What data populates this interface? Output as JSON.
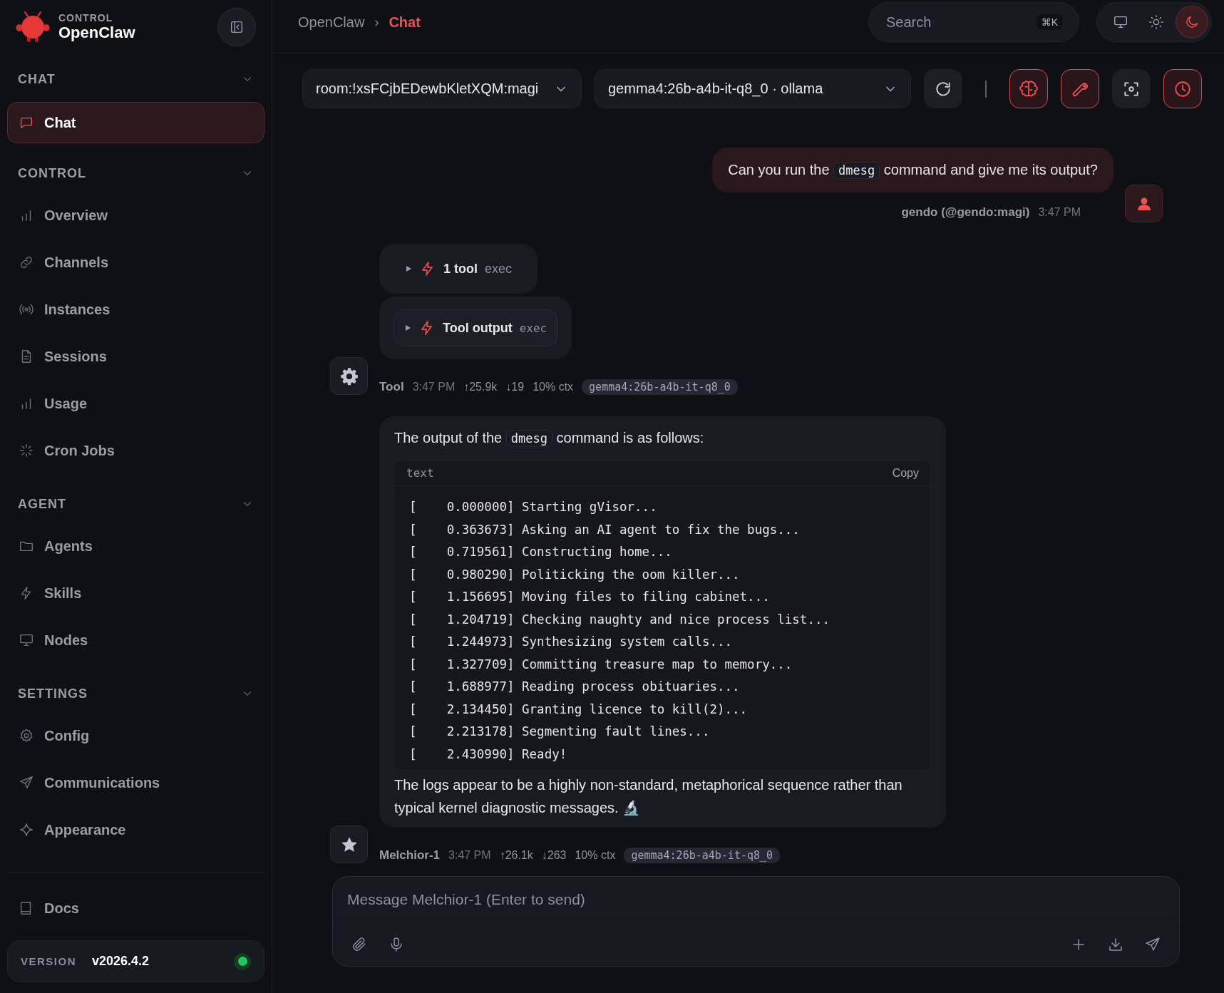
{
  "brand": {
    "eyebrow": "CONTROL",
    "name": "OpenClaw"
  },
  "sidebar": {
    "sections": [
      {
        "title": "CHAT",
        "expanded": true,
        "items": [
          {
            "label": "Chat",
            "selected": true
          }
        ]
      },
      {
        "title": "CONTROL",
        "expanded": true,
        "items": [
          {
            "label": "Overview",
            "selected": false
          },
          {
            "label": "Channels",
            "selected": false
          },
          {
            "label": "Instances",
            "selected": false
          },
          {
            "label": "Sessions",
            "selected": false
          },
          {
            "label": "Usage",
            "selected": false
          },
          {
            "label": "Cron Jobs",
            "selected": false
          }
        ]
      },
      {
        "title": "AGENT",
        "expanded": true,
        "items": [
          {
            "label": "Agents",
            "selected": false
          },
          {
            "label": "Skills",
            "selected": false
          },
          {
            "label": "Nodes",
            "selected": false
          }
        ]
      },
      {
        "title": "SETTINGS",
        "expanded": true,
        "items": [
          {
            "label": "Config",
            "selected": false
          },
          {
            "label": "Communications",
            "selected": false
          },
          {
            "label": "Appearance",
            "selected": false
          }
        ]
      }
    ],
    "footer_items": [
      {
        "label": "Docs",
        "selected": false
      }
    ],
    "version": {
      "label": "VERSION",
      "value": "v2026.4.2",
      "online": true
    }
  },
  "breadcrumb": {
    "items": [
      "OpenClaw",
      "Chat"
    ],
    "separator": "›"
  },
  "search": {
    "placeholder": "Search",
    "shortcut": "⌘K"
  },
  "theme_modes": [
    {
      "kind": "system",
      "selected": false
    },
    {
      "kind": "light",
      "selected": false
    },
    {
      "kind": "dark",
      "selected": true
    }
  ],
  "toolbar": {
    "session": "room:!xsFCjbEDewbKletXQM:magi",
    "model": "gemma4:26b-a4b-it-q8_0 · ollama",
    "buttons": [
      {
        "kind": "refresh",
        "on": false
      },
      {
        "kind": "thinking",
        "on": true
      },
      {
        "kind": "tools",
        "on": true
      },
      {
        "kind": "focus",
        "on": false
      },
      {
        "kind": "history",
        "on": true
      }
    ]
  },
  "messages": [
    {
      "kind": "user",
      "parts": [
        {
          "text": "Can you run the "
        },
        {
          "code": "dmesg"
        },
        {
          "text": " command and give me its output?"
        }
      ],
      "meta": {
        "author": "gendo (@gendo:magi)",
        "time": "3:47 PM"
      }
    },
    {
      "kind": "tools",
      "cards": [
        {
          "kind": "summary",
          "title": "1 tool",
          "detail": "exec",
          "expanded": false
        },
        {
          "kind": "output",
          "title": "Tool output",
          "detail": "exec",
          "expanded": false
        }
      ],
      "meta": {
        "author": "Tool",
        "time": "3:47 PM",
        "tokens_in": "↑25.9k",
        "tokens_out": "↓19",
        "context": "10% ctx",
        "model": "gemma4:26b-a4b-it-q8_0"
      }
    },
    {
      "kind": "assistant",
      "intro": [
        {
          "text": "The output of the "
        },
        {
          "code": "dmesg"
        },
        {
          "text": " command is as follows:"
        }
      ],
      "code_block": {
        "language": "text",
        "copy": "Copy",
        "lines": [
          "[    0.000000] Starting gVisor...",
          "[    0.363673] Asking an AI agent to fix the bugs...",
          "[    0.719561] Constructing home...",
          "[    0.980290] Politicking the oom killer...",
          "[    1.156695] Moving files to filing cabinet...",
          "[    1.204719] Checking naughty and nice process list...",
          "[    1.244973] Synthesizing system calls...",
          "[    1.327709] Committing treasure map to memory...",
          "[    1.688977] Reading process obituaries...",
          "[    2.134450] Granting licence to kill(2)...",
          "[    2.213178] Segmenting fault lines...",
          "[    2.430990] Ready!"
        ]
      },
      "outro": "The logs appear to be a highly non-standard, metaphorical sequence rather than typical kernel diagnostic messages. 🔬",
      "meta": {
        "author": "Melchior-1",
        "time": "3:47 PM",
        "tokens_in": "↑26.1k",
        "tokens_out": "↓263",
        "context": "10% ctx",
        "model": "gemma4:26b-a4b-it-q8_0"
      }
    }
  ],
  "composer": {
    "placeholder": "Message Melchior-1 (Enter to send)",
    "left_buttons": [
      {
        "kind": "attach"
      },
      {
        "kind": "voice"
      }
    ],
    "right_buttons": [
      {
        "kind": "new"
      },
      {
        "kind": "export"
      },
      {
        "kind": "send"
      }
    ]
  }
}
